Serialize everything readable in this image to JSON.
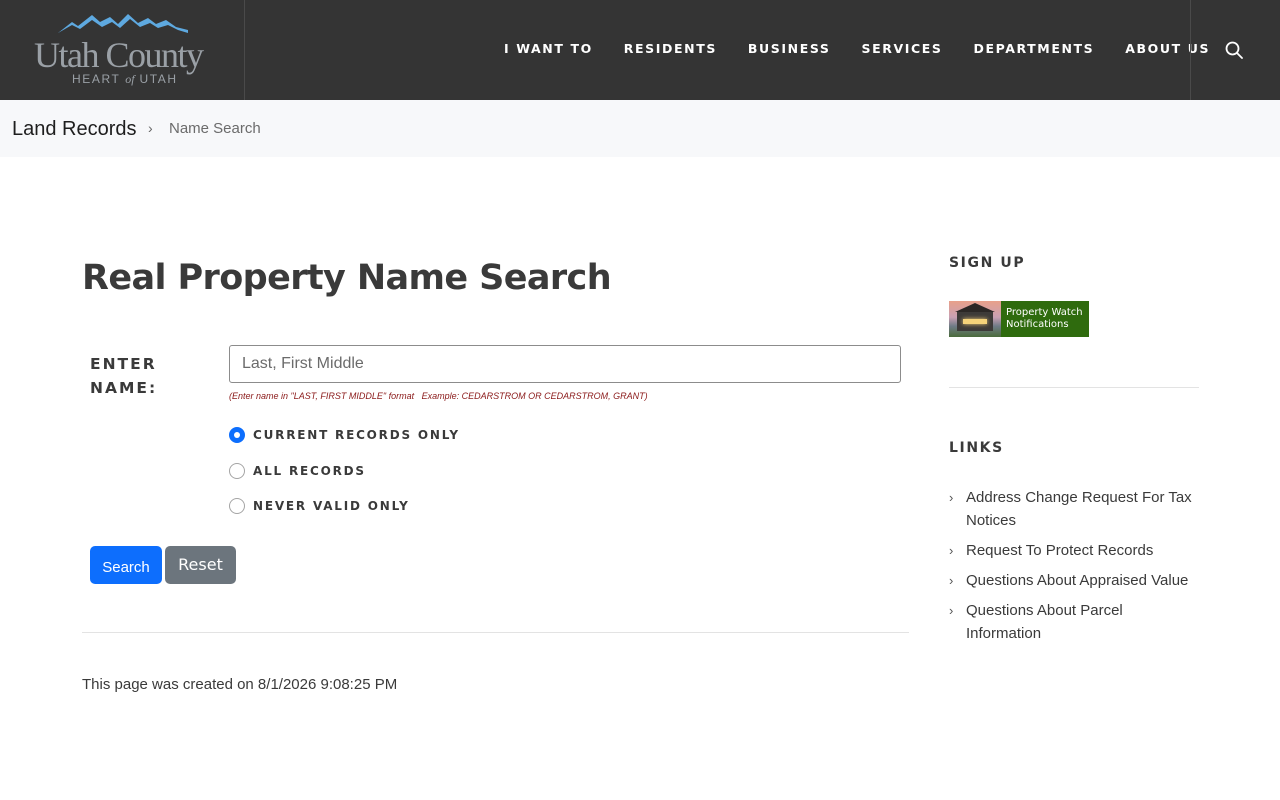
{
  "header": {
    "logo_main": "Utah County",
    "logo_sub_left": "HEART",
    "logo_sub_of": "of",
    "logo_sub_right": "UTAH",
    "nav": [
      "I WANT TO",
      "RESIDENTS",
      "BUSINESS",
      "SERVICES",
      "DEPARTMENTS",
      "ABOUT US"
    ]
  },
  "breadcrumb": {
    "home": "Land Records",
    "separator": "›",
    "current": "Name Search"
  },
  "main": {
    "title": "Real Property Name Search",
    "label": "ENTER NAME:",
    "input_placeholder": "Last, First Middle",
    "input_value": "",
    "hint": "(Enter name in \"LAST, FIRST MIDDLE\" format   Example: CEDARSTROM OR CEDARSTROM, GRANT)",
    "radios": [
      {
        "label": "CURRENT RECORDS ONLY",
        "checked": true
      },
      {
        "label": "ALL RECORDS",
        "checked": false
      },
      {
        "label": "NEVER VALID ONLY",
        "checked": false
      }
    ],
    "search_label": "Search",
    "reset_label": "Reset",
    "created": "This page was created on 8/1/2026 9:08:25 PM"
  },
  "sidebar": {
    "signup_heading": "SIGN UP",
    "banner_line1": "Property Watch",
    "banner_line2": "Notifications",
    "links_heading": "LINKS",
    "links": [
      "Address Change Request For Tax Notices",
      "Request To Protect Records",
      "Questions About Appraised Value",
      "Questions About Parcel Information"
    ]
  },
  "colors": {
    "header_bg": "#343434",
    "primary": "#0d6efd",
    "secondary": "#6c757d",
    "hint": "#8b1a1a",
    "banner_green": "#2f6b0e"
  }
}
